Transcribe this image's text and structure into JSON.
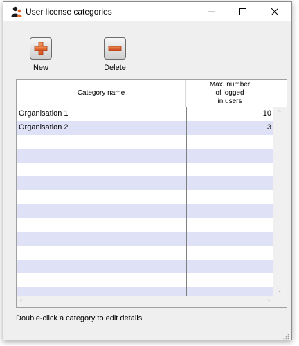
{
  "window": {
    "title": "User license categories",
    "icon": "people-icon",
    "controls": [
      "minimize-icon",
      "maximize-icon",
      "close-icon"
    ]
  },
  "toolbar": {
    "new_label": "New",
    "delete_label": "Delete",
    "new_icon": "plus-icon",
    "delete_icon": "minus-icon",
    "new_color": "#e2652a",
    "delete_color": "#d9542a"
  },
  "table": {
    "columns": {
      "name": "Category name",
      "max_line1": "Max. number",
      "max_line2": "of logged",
      "max_line3": "in users"
    },
    "rows": [
      {
        "name": "Organisation 1",
        "max": "10"
      },
      {
        "name": "Organisation 2",
        "max": "3"
      }
    ],
    "stripe_color": "#dfe1f7"
  },
  "status": {
    "hint": "Double-click a category to edit details"
  }
}
